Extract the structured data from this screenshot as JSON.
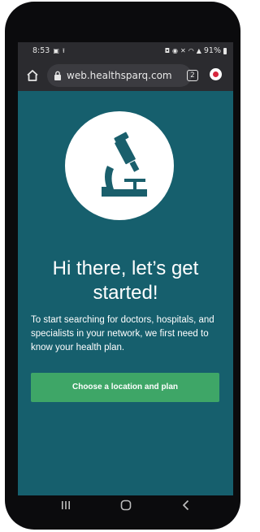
{
  "status_bar": {
    "time": "8:53",
    "battery": "91%"
  },
  "browser": {
    "url": "web.healthsparq.com",
    "tab_count": "2"
  },
  "main": {
    "headline": "Hi there, let’s get started!",
    "intro": "To start searching for doctors, hospitals, and specialists in your network, we first need to know your health plan.",
    "cta_label": "Choose a location and plan"
  },
  "colors": {
    "page_background": "#165f6d",
    "cta_green": "#3ea667",
    "icon_teal": "#1a5f6c"
  }
}
